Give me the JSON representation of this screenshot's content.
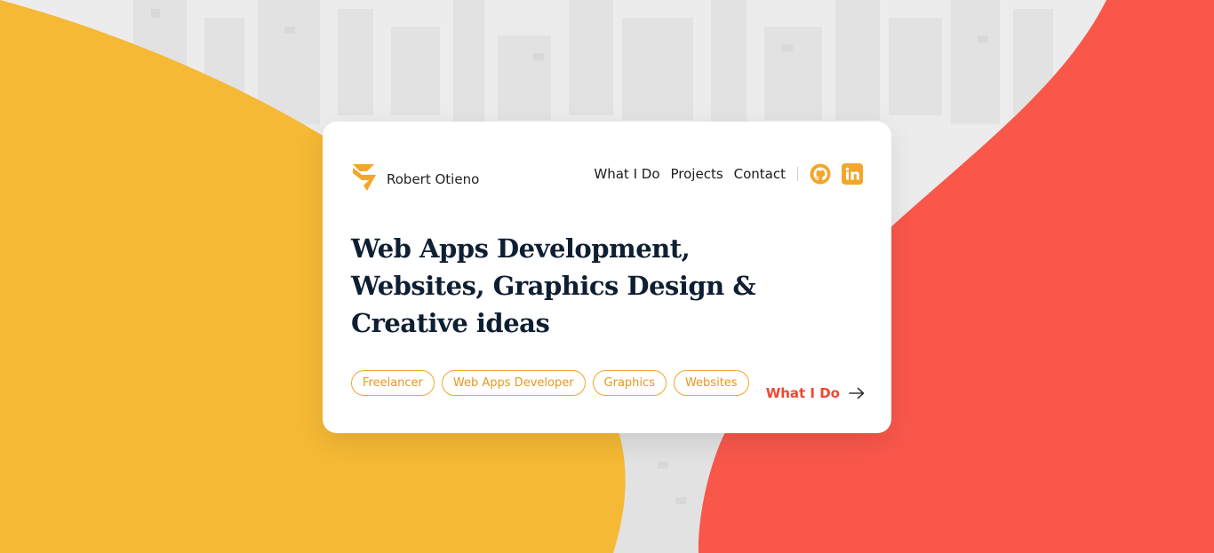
{
  "brand": {
    "name": "Robert Otieno",
    "logo_icon": "chevron-stripes-logo",
    "accent_color": "#f2a62a"
  },
  "nav": {
    "items": [
      {
        "label": "What I Do"
      },
      {
        "label": "Projects"
      },
      {
        "label": "Contact"
      }
    ],
    "social": [
      {
        "icon": "github-icon"
      },
      {
        "icon": "linkedin-icon"
      }
    ]
  },
  "hero": {
    "headline": "Web Apps Development, Websites, Graphics Design & Creative ideas",
    "tags": [
      "Freelancer",
      "Web Apps Developer",
      "Graphics",
      "Websites"
    ],
    "cta_label": "What I Do"
  },
  "colors": {
    "yellow_blob": "#f5b935",
    "red_blob": "#f9574a",
    "headline": "#0f1f33",
    "cta": "#f1462f"
  }
}
